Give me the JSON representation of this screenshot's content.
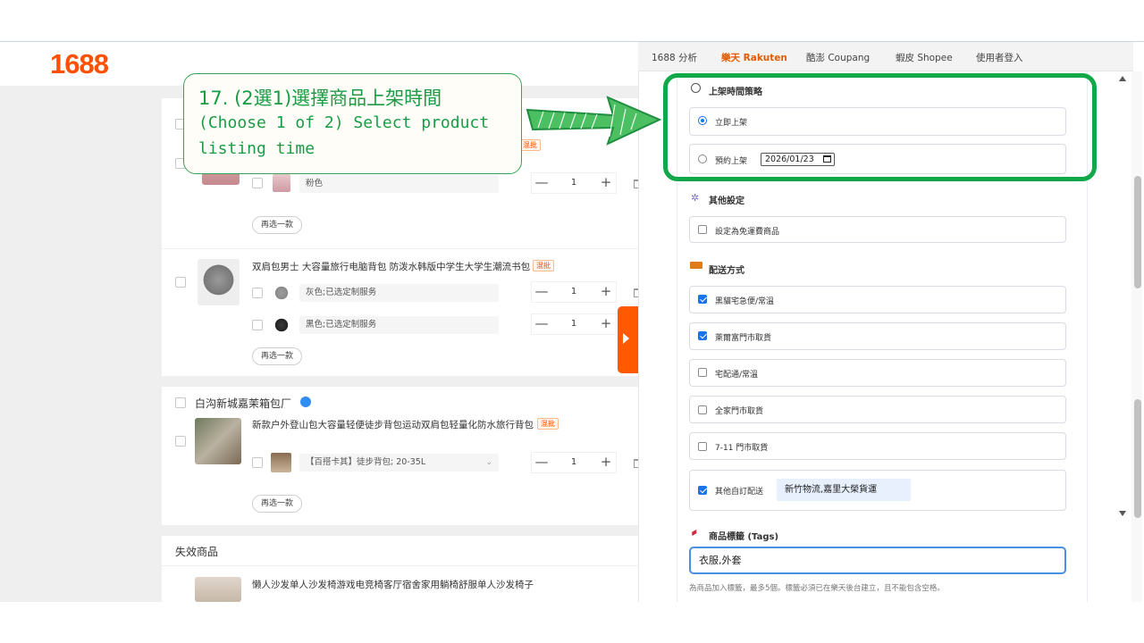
{
  "app": {
    "logo": "1688"
  },
  "cart": {
    "items": [
      {
        "variants": [
          {
            "label": "粉色",
            "qty": "1"
          }
        ],
        "reselect": "再选一款"
      },
      {
        "title": "双肩包男士 大容量旅行电脑背包 防泼水韩版中学生大学生潮流书包",
        "badge": "混批",
        "variants": [
          {
            "label": "灰色;已选定制服务",
            "qty": "1"
          },
          {
            "label": "黑色;已选定制服务",
            "qty": "1"
          }
        ],
        "reselect": "再选一款"
      },
      {
        "shop": "白沟新城嘉茉箱包厂",
        "title": "新款户外登山包大容量轻便徒步背包运动双肩包轻量化防水旅行背包",
        "badge": "混批",
        "variants": [
          {
            "label": "【百搭卡其】徒步背包; 20-35L",
            "qty": "1"
          }
        ],
        "reselect": "再选一款"
      }
    ],
    "invalid": {
      "heading": "失效商品",
      "title": "懒人沙发单人沙发椅游戏电竞椅客厅宿舍家用躺椅舒服单人沙发椅子"
    },
    "qty_minus": "—",
    "qty_plus": "+"
  },
  "panel": {
    "tabs": [
      {
        "label": "1688 分析",
        "active": false
      },
      {
        "label": "樂天 Rakuten",
        "active": true
      },
      {
        "label": "酷澎 Coupang",
        "active": false
      },
      {
        "label": "蝦皮 Shopee",
        "active": false
      },
      {
        "label": "使用者登入",
        "active": false
      }
    ],
    "listing": {
      "heading": "上架時間策略",
      "icon": "clock-icon",
      "immediate": "立即上架",
      "scheduled": "預約上架",
      "date": "2026/01/23",
      "selected": "immediate"
    },
    "other": {
      "heading": "其他設定",
      "icon": "gear-icon",
      "free_shipping": "設定為免運費商品",
      "free_shipping_checked": false
    },
    "shipping": {
      "heading": "配送方式",
      "icon": "truck-icon",
      "options": [
        {
          "label": "黑貓宅急便/常溫",
          "checked": true
        },
        {
          "label": "萊爾富門市取貨",
          "checked": true
        },
        {
          "label": "宅配通/常溫",
          "checked": false
        },
        {
          "label": "全家門市取貨",
          "checked": false
        },
        {
          "label": "7-11 門市取貨",
          "checked": false
        }
      ],
      "custom_label": "其他自訂配送",
      "custom_checked": true,
      "custom_value": "新竹物流,嘉里大榮貨運"
    },
    "tags": {
      "heading": "商品標籤 (Tags)",
      "icon": "tag-icon",
      "value": "衣服,外套",
      "hint": "為商品加入標籤，最多5個。標籤必須已在樂天後台建立，且不能包含空格。"
    }
  },
  "annotation": {
    "zh": "17. (2選1)選擇商品上架時間",
    "en_line1": "(Choose 1 of 2) Select product",
    "en_line2": "listing time",
    "color": "#11a84a"
  }
}
